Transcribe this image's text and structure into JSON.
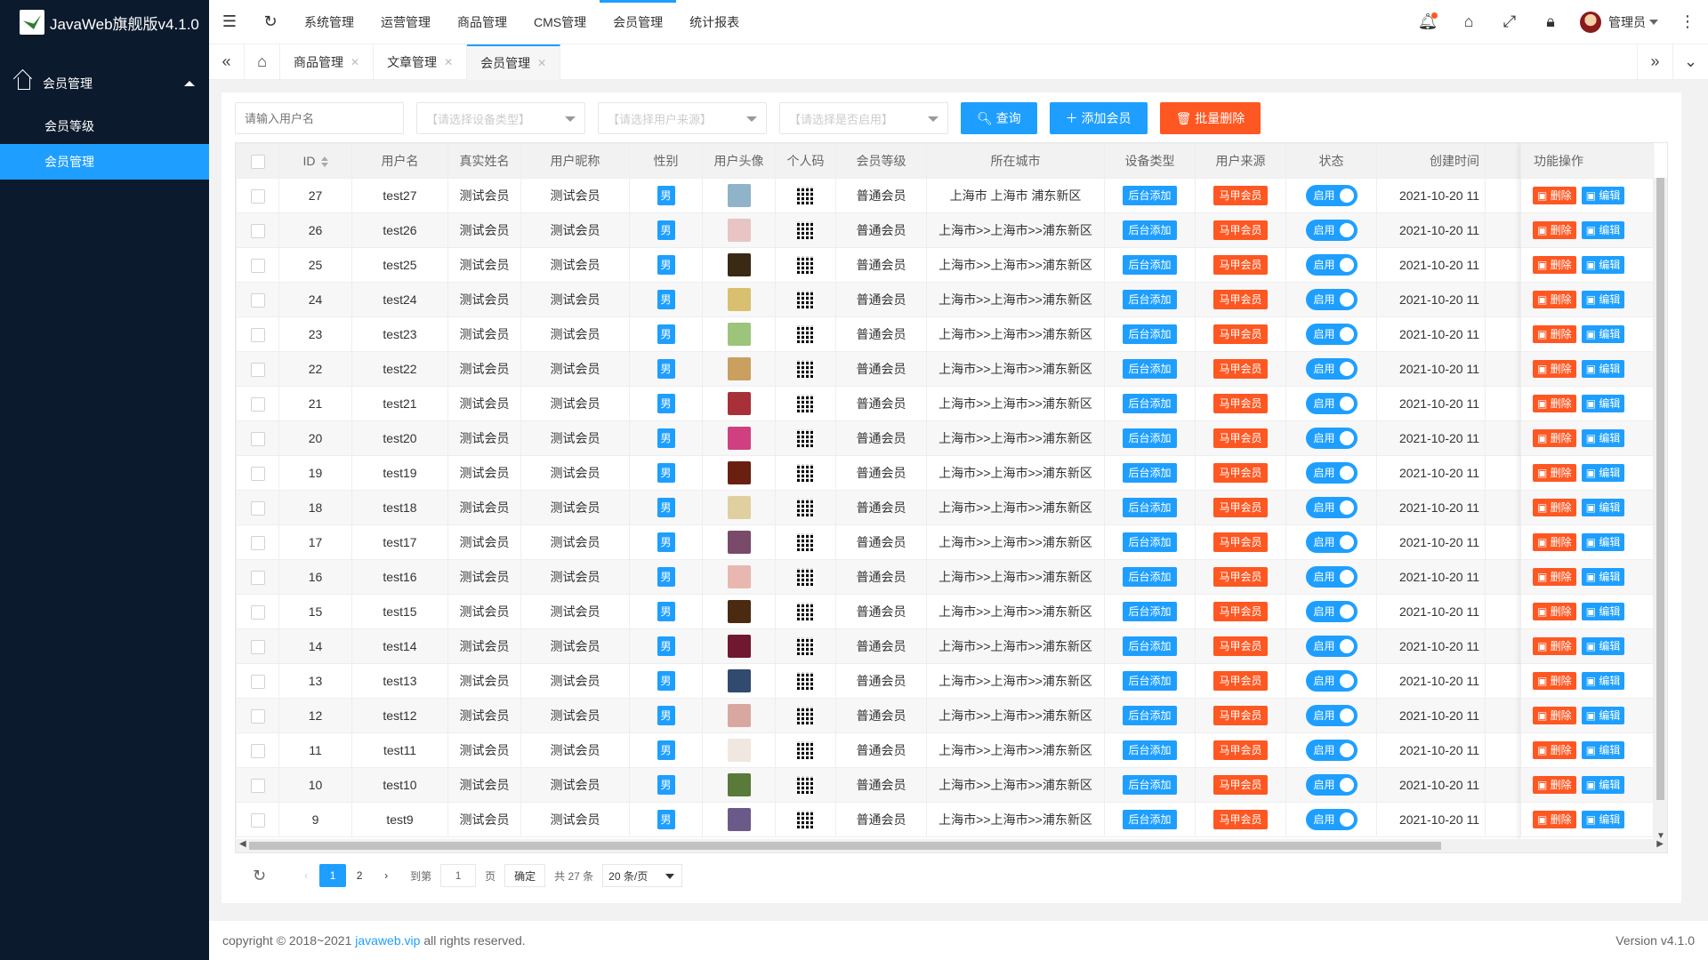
{
  "app": {
    "title": "JavaWeb旗舰版v4.1.0"
  },
  "sidebar": {
    "parent": "会员管理",
    "items": [
      {
        "label": "会员等级",
        "active": false
      },
      {
        "label": "会员管理",
        "active": true
      }
    ]
  },
  "topnav": {
    "items": [
      "系统管理",
      "运营管理",
      "商品管理",
      "CMS管理",
      "会员管理",
      "统计报表"
    ],
    "active": "会员管理",
    "user": "管理员"
  },
  "tabs": [
    {
      "label": "商品管理",
      "active": false
    },
    {
      "label": "文章管理",
      "active": false
    },
    {
      "label": "会员管理",
      "active": true
    }
  ],
  "filters": {
    "username_placeholder": "请输入用户名",
    "device_placeholder": "【请选择设备类型】",
    "source_placeholder": "【请选择用户来源】",
    "enabled_placeholder": "【请选择是否启用】"
  },
  "buttons": {
    "query": "查询",
    "add": "添加会员",
    "batch_delete": "批量删除"
  },
  "table": {
    "columns": [
      "ID",
      "用户名",
      "真实姓名",
      "用户昵称",
      "性别",
      "用户头像",
      "个人码",
      "会员等级",
      "所在城市",
      "设备类型",
      "用户来源",
      "状态",
      "创建时间",
      "功能操作"
    ],
    "rows": [
      {
        "id": "27",
        "username": "test27",
        "realname": "测试会员",
        "nickname": "测试会员",
        "gender": "男",
        "level": "普通会员",
        "city": "上海市 上海市 浦东新区",
        "device": "后台添加",
        "source": "马甲会员",
        "status": "启用",
        "created": "2021-10-20 11",
        "avatar": "#8fb3c9"
      },
      {
        "id": "26",
        "username": "test26",
        "realname": "测试会员",
        "nickname": "测试会员",
        "gender": "男",
        "level": "普通会员",
        "city": "上海市>>上海市>>浦东新区",
        "device": "后台添加",
        "source": "马甲会员",
        "status": "启用",
        "created": "2021-10-20 11",
        "avatar": "#e8c4c4"
      },
      {
        "id": "25",
        "username": "test25",
        "realname": "测试会员",
        "nickname": "测试会员",
        "gender": "男",
        "level": "普通会员",
        "city": "上海市>>上海市>>浦东新区",
        "device": "后台添加",
        "source": "马甲会员",
        "status": "启用",
        "created": "2021-10-20 11",
        "avatar": "#3a2a14"
      },
      {
        "id": "24",
        "username": "test24",
        "realname": "测试会员",
        "nickname": "测试会员",
        "gender": "男",
        "level": "普通会员",
        "city": "上海市>>上海市>>浦东新区",
        "device": "后台添加",
        "source": "马甲会员",
        "status": "启用",
        "created": "2021-10-20 11",
        "avatar": "#d8c070"
      },
      {
        "id": "23",
        "username": "test23",
        "realname": "测试会员",
        "nickname": "测试会员",
        "gender": "男",
        "level": "普通会员",
        "city": "上海市>>上海市>>浦东新区",
        "device": "后台添加",
        "source": "马甲会员",
        "status": "启用",
        "created": "2021-10-20 11",
        "avatar": "#9cc47a"
      },
      {
        "id": "22",
        "username": "test22",
        "realname": "测试会员",
        "nickname": "测试会员",
        "gender": "男",
        "level": "普通会员",
        "city": "上海市>>上海市>>浦东新区",
        "device": "后台添加",
        "source": "马甲会员",
        "status": "启用",
        "created": "2021-10-20 11",
        "avatar": "#c9a060"
      },
      {
        "id": "21",
        "username": "test21",
        "realname": "测试会员",
        "nickname": "测试会员",
        "gender": "男",
        "level": "普通会员",
        "city": "上海市>>上海市>>浦东新区",
        "device": "后台添加",
        "source": "马甲会员",
        "status": "启用",
        "created": "2021-10-20 11",
        "avatar": "#a83038"
      },
      {
        "id": "20",
        "username": "test20",
        "realname": "测试会员",
        "nickname": "测试会员",
        "gender": "男",
        "level": "普通会员",
        "city": "上海市>>上海市>>浦东新区",
        "device": "后台添加",
        "source": "马甲会员",
        "status": "启用",
        "created": "2021-10-20 11",
        "avatar": "#d04080"
      },
      {
        "id": "19",
        "username": "test19",
        "realname": "测试会员",
        "nickname": "测试会员",
        "gender": "男",
        "level": "普通会员",
        "city": "上海市>>上海市>>浦东新区",
        "device": "后台添加",
        "source": "马甲会员",
        "status": "启用",
        "created": "2021-10-20 11",
        "avatar": "#6a2010"
      },
      {
        "id": "18",
        "username": "test18",
        "realname": "测试会员",
        "nickname": "测试会员",
        "gender": "男",
        "level": "普通会员",
        "city": "上海市>>上海市>>浦东新区",
        "device": "后台添加",
        "source": "马甲会员",
        "status": "启用",
        "created": "2021-10-20 11",
        "avatar": "#e0d0a0"
      },
      {
        "id": "17",
        "username": "test17",
        "realname": "测试会员",
        "nickname": "测试会员",
        "gender": "男",
        "level": "普通会员",
        "city": "上海市>>上海市>>浦东新区",
        "device": "后台添加",
        "source": "马甲会员",
        "status": "启用",
        "created": "2021-10-20 11",
        "avatar": "#7a4a6a"
      },
      {
        "id": "16",
        "username": "test16",
        "realname": "测试会员",
        "nickname": "测试会员",
        "gender": "男",
        "level": "普通会员",
        "city": "上海市>>上海市>>浦东新区",
        "device": "后台添加",
        "source": "马甲会员",
        "status": "启用",
        "created": "2021-10-20 11",
        "avatar": "#e8b8b0"
      },
      {
        "id": "15",
        "username": "test15",
        "realname": "测试会员",
        "nickname": "测试会员",
        "gender": "男",
        "level": "普通会员",
        "city": "上海市>>上海市>>浦东新区",
        "device": "后台添加",
        "source": "马甲会员",
        "status": "启用",
        "created": "2021-10-20 11",
        "avatar": "#4a2a10"
      },
      {
        "id": "14",
        "username": "test14",
        "realname": "测试会员",
        "nickname": "测试会员",
        "gender": "男",
        "level": "普通会员",
        "city": "上海市>>上海市>>浦东新区",
        "device": "后台添加",
        "source": "马甲会员",
        "status": "启用",
        "created": "2021-10-20 11",
        "avatar": "#701830"
      },
      {
        "id": "13",
        "username": "test13",
        "realname": "测试会员",
        "nickname": "测试会员",
        "gender": "男",
        "level": "普通会员",
        "city": "上海市>>上海市>>浦东新区",
        "device": "后台添加",
        "source": "马甲会员",
        "status": "启用",
        "created": "2021-10-20 11",
        "avatar": "#304a70"
      },
      {
        "id": "12",
        "username": "test12",
        "realname": "测试会员",
        "nickname": "测试会员",
        "gender": "男",
        "level": "普通会员",
        "city": "上海市>>上海市>>浦东新区",
        "device": "后台添加",
        "source": "马甲会员",
        "status": "启用",
        "created": "2021-10-20 11",
        "avatar": "#d8a8a0"
      },
      {
        "id": "11",
        "username": "test11",
        "realname": "测试会员",
        "nickname": "测试会员",
        "gender": "男",
        "level": "普通会员",
        "city": "上海市>>上海市>>浦东新区",
        "device": "后台添加",
        "source": "马甲会员",
        "status": "启用",
        "created": "2021-10-20 11",
        "avatar": "#f0e8e0"
      },
      {
        "id": "10",
        "username": "test10",
        "realname": "测试会员",
        "nickname": "测试会员",
        "gender": "男",
        "level": "普通会员",
        "city": "上海市>>上海市>>浦东新区",
        "device": "后台添加",
        "source": "马甲会员",
        "status": "启用",
        "created": "2021-10-20 11",
        "avatar": "#5a7a3a"
      },
      {
        "id": "9",
        "username": "test9",
        "realname": "测试会员",
        "nickname": "测试会员",
        "gender": "男",
        "level": "普通会员",
        "city": "上海市>>上海市>>浦东新区",
        "device": "后台添加",
        "source": "马甲会员",
        "status": "启用",
        "created": "2021-10-20 11",
        "avatar": "#6a5a8a"
      }
    ],
    "ops": {
      "delete": "删除",
      "edit": "编辑"
    }
  },
  "pager": {
    "pages": [
      "1",
      "2"
    ],
    "current": "1",
    "goto_label": "到第",
    "goto_value": "1",
    "page_unit": "页",
    "confirm": "确定",
    "total": "共 27 条",
    "page_size": "20 条/页"
  },
  "footer": {
    "copyright_prefix": "copyright © 2018~2021",
    "link": "javaweb.vip",
    "copyright_suffix": "all rights reserved.",
    "version": "Version v4.1.0"
  },
  "colors": {
    "primary": "#1e9fff",
    "danger": "#ff5722",
    "sidebar_bg": "#0c1a2d"
  }
}
